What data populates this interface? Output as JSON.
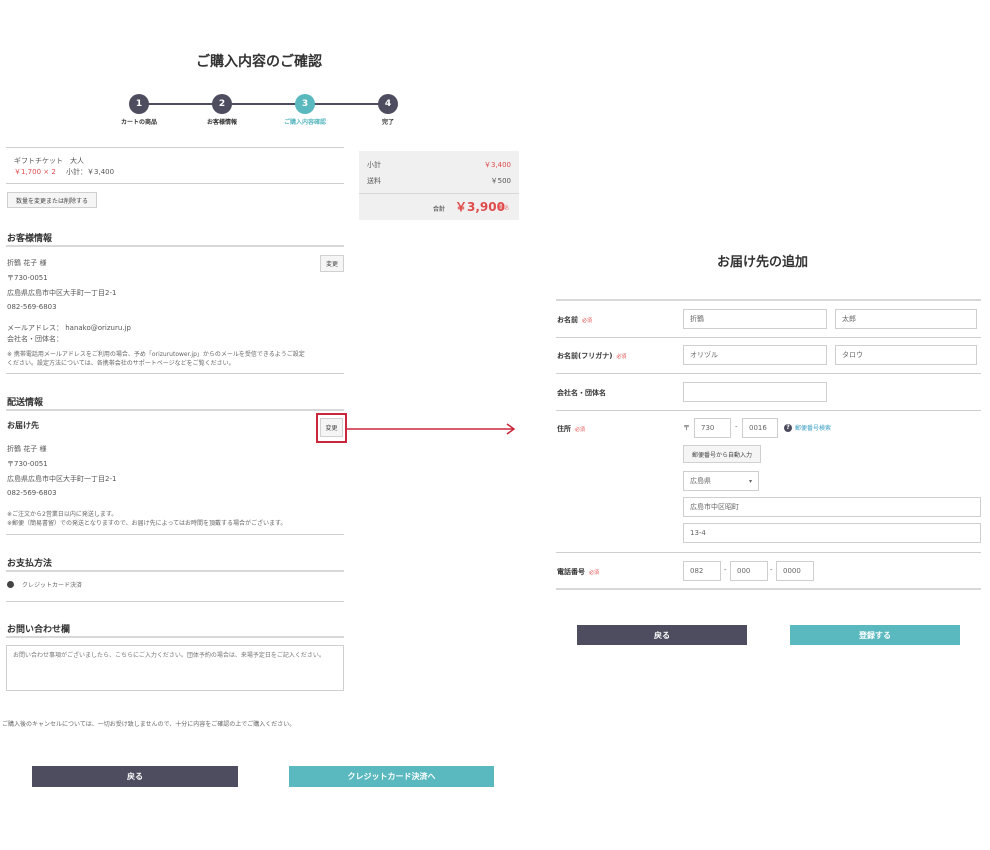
{
  "left": {
    "page_title": "ご購入内容のご確認",
    "steps": [
      {
        "num": "1",
        "label": "カートの商品"
      },
      {
        "num": "2",
        "label": "お客様情報"
      },
      {
        "num": "3",
        "label": "ご購入内容確認"
      },
      {
        "num": "4",
        "label": "完了"
      }
    ],
    "cart_item": {
      "name": "ギフトチケット　大人",
      "price_qty": "￥1,700 × 2",
      "subtotal": "小計：￥3,400"
    },
    "change_qty_button": "数量を変更または削除する",
    "summary": {
      "subtotal_label": "小計",
      "subtotal_value": "￥3,400",
      "shipping_label": "送料",
      "shipping_value": "￥500",
      "total_label": "合計",
      "total_value": "￥3,900",
      "tax_note": "税込"
    },
    "customer": {
      "heading": "お客様情報",
      "change_button": "変更",
      "name": "折鶴 花子 様",
      "zip": "〒730-0051",
      "address": "広島県広島市中区大手町一丁目2-1",
      "phone": "082-569-6803",
      "email": "メールアドレス： hanako@orizuru.jp",
      "company": "会社名・団体名：",
      "note1": "※ 携帯電話用メールアドレスをご利用の場合、予め「orizurutower.jp」からのメールを受信できるようご設定",
      "note2": "ください。設定方法については、各携帯会社のサポートページなどをご覧ください。"
    },
    "shipping": {
      "heading": "配送情報",
      "sub_heading": "お届け先",
      "change_button": "変更",
      "name": "折鶴 花子 様",
      "zip": "〒730-0051",
      "address": "広島県広島市中区大手町一丁目2-1",
      "phone": "082-569-6803",
      "note1": "※ご注文から2営業日以内に発送します。",
      "note2": "※郵便（簡易書留）での発送となりますので、お届け先によってはお時間を頂戴する場合がございます。"
    },
    "payment": {
      "heading": "お支払方法",
      "option": "クレジットカード決済"
    },
    "inquiry": {
      "heading": "お問い合わせ欄",
      "placeholder": "お問い合わせ事項がございましたら、こちらにご入力ください。団体予約の場合は、来場予定日をご記入ください。"
    },
    "cancel_note": "ご購入後のキャンセルについては、一切お受け致しませんので、十分に内容をご確認の上でご購入ください。",
    "back_button": "戻る",
    "pay_button": "クレジットカード決済へ"
  },
  "right": {
    "title": "お届け先の追加",
    "required": "必須",
    "name_label": "お名前",
    "last_name": "折鶴",
    "first_name": "太郎",
    "kana_label": "お名前(フリガナ)",
    "last_kana": "オリヅル",
    "first_kana": "タロウ",
    "company_label": "会社名・団体名",
    "address_label": "住所",
    "zip_mark": "〒",
    "zip1": "730",
    "zip_sep": "-",
    "zip2": "0016",
    "zip_search_link": "郵便番号検索",
    "auto_fill_button": "郵便番号から自動入力",
    "prefecture": "広島県",
    "city": "広島市中区昭町",
    "street": "13-4",
    "phone_label": "電話番号",
    "phone1": "082",
    "phone2": "000",
    "phone3": "0000",
    "back_button": "戻る",
    "register_button": "登録する"
  },
  "colors": {
    "dark": "#4e4d5f",
    "teal": "#5ab8bf",
    "red": "#e04c4c",
    "highlight": "#c8283c"
  }
}
